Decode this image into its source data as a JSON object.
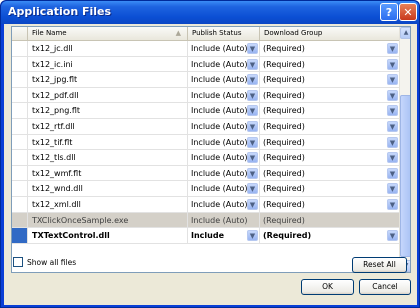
{
  "window": {
    "title": "Application Files",
    "help_glyph": "?",
    "close_glyph": "✕"
  },
  "grid": {
    "columns": [
      "File Name",
      "Publish Status",
      "Download Group"
    ],
    "sort_glyph": "▲",
    "dropdown_glyph": "▼",
    "rows": [
      {
        "name": "tx12_jc.dll",
        "status": "Include (Auto)",
        "group": "(Required)",
        "style": "normal"
      },
      {
        "name": "tx12_ic.ini",
        "status": "Include (Auto)",
        "group": "(Required)",
        "style": "normal"
      },
      {
        "name": "tx12_jpg.flt",
        "status": "Include (Auto)",
        "group": "(Required)",
        "style": "normal"
      },
      {
        "name": "tx12_pdf.dll",
        "status": "Include (Auto)",
        "group": "(Required)",
        "style": "normal"
      },
      {
        "name": "tx12_png.flt",
        "status": "Include (Auto)",
        "group": "(Required)",
        "style": "normal"
      },
      {
        "name": "tx12_rtf.dll",
        "status": "Include (Auto)",
        "group": "(Required)",
        "style": "normal"
      },
      {
        "name": "tx12_tif.flt",
        "status": "Include (Auto)",
        "group": "(Required)",
        "style": "normal"
      },
      {
        "name": "tx12_tls.dll",
        "status": "Include (Auto)",
        "group": "(Required)",
        "style": "normal"
      },
      {
        "name": "tx12_wmf.flt",
        "status": "Include (Auto)",
        "group": "(Required)",
        "style": "normal"
      },
      {
        "name": "tx12_wnd.dll",
        "status": "Include (Auto)",
        "group": "(Required)",
        "style": "normal"
      },
      {
        "name": "tx12_xml.dll",
        "status": "Include (Auto)",
        "group": "(Required)",
        "style": "normal"
      },
      {
        "name": "TXClickOnceSample.exe",
        "status": "Include (Auto)",
        "group": "(Required)",
        "style": "gray"
      },
      {
        "name": "TXTextControl.dll",
        "status": "Include",
        "group": "(Required)",
        "style": "selected"
      }
    ]
  },
  "scrollbar": {
    "up_glyph": "▲",
    "down_glyph": "▼"
  },
  "options": {
    "show_all_files_label": "Show all files",
    "show_all_files_checked": false
  },
  "buttons": {
    "reset": "Reset All",
    "ok": "OK",
    "cancel": "Cancel"
  }
}
